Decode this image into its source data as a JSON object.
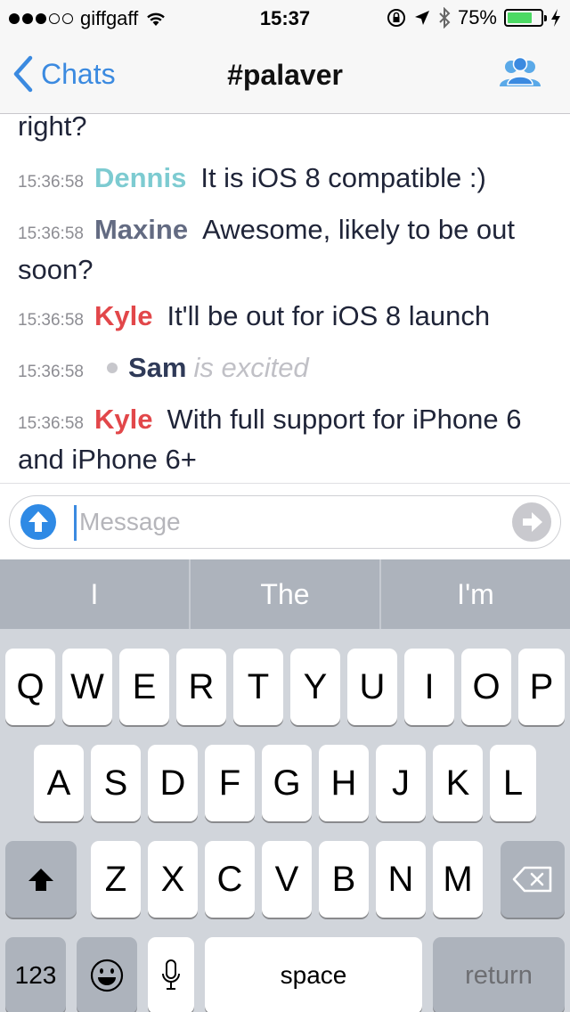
{
  "status_bar": {
    "carrier": "giffgaff",
    "time": "15:37",
    "battery_percent": "75%",
    "battery_level": 0.75,
    "signal_bars_filled": 3,
    "signal_bars_total": 5,
    "icons": [
      "wifi-icon",
      "orientation-lock-icon",
      "location-arrow-icon",
      "bluetooth-icon",
      "battery-icon",
      "charging-bolt-icon"
    ]
  },
  "nav": {
    "back_label": "Chats",
    "title": "#palaver",
    "right_icon": "users-icon"
  },
  "messages": [
    {
      "type": "continuation",
      "text": "right?"
    },
    {
      "type": "message",
      "time": "15:36:58",
      "nick": "Dennis",
      "color": "#7dcbd1",
      "text": "It is iOS 8 compatible :)"
    },
    {
      "type": "message",
      "time": "15:36:58",
      "nick": "Maxine",
      "color": "#636b82",
      "text": "Awesome, likely to be out soon?"
    },
    {
      "type": "message",
      "time": "15:36:58",
      "nick": "Kyle",
      "color": "#e2474a",
      "text": "It'll be out for iOS 8 launch"
    },
    {
      "type": "action",
      "time": "15:36:58",
      "nick": "Sam",
      "text": "is excited"
    },
    {
      "type": "message",
      "time": "15:36:58",
      "nick": "Kyle",
      "color": "#e2474a",
      "text": "With full support for iPhone 6 and iPhone 6+"
    }
  ],
  "composer": {
    "placeholder": "Message",
    "value": ""
  },
  "keyboard": {
    "suggestions": [
      "I",
      "The",
      "I'm"
    ],
    "row1": [
      "Q",
      "W",
      "E",
      "R",
      "T",
      "Y",
      "U",
      "I",
      "O",
      "P"
    ],
    "row2": [
      "A",
      "S",
      "D",
      "F",
      "G",
      "H",
      "J",
      "K",
      "L"
    ],
    "row3": [
      "Z",
      "X",
      "C",
      "V",
      "B",
      "N",
      "M"
    ],
    "numbers_label": "123",
    "space_label": "space",
    "return_label": "return"
  },
  "colors": {
    "accent": "#3b8ae0",
    "keyboard_bg": "#d1d5db",
    "suggestion_bg": "#adb3bc"
  }
}
